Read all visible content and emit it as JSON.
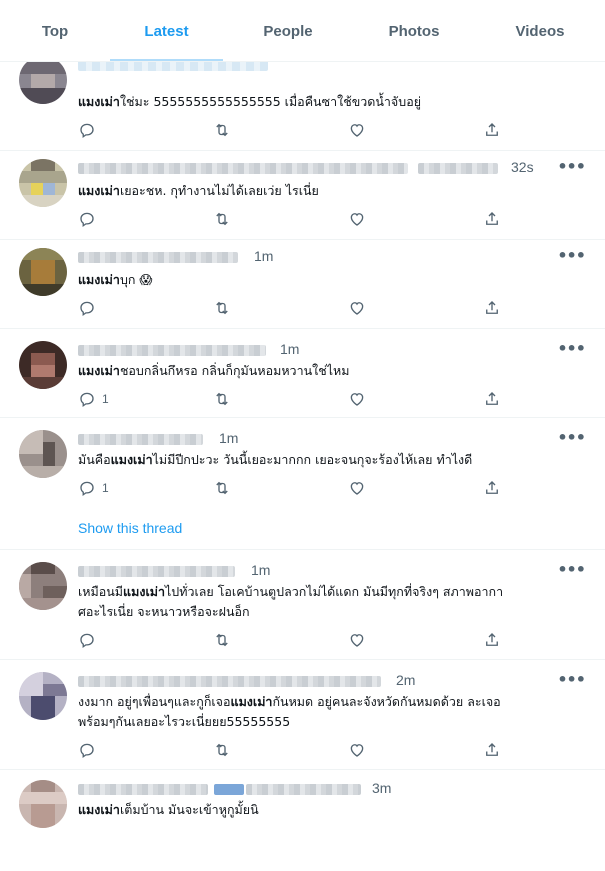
{
  "tabs": [
    {
      "label": "Top",
      "active": false
    },
    {
      "label": "Latest",
      "active": true
    },
    {
      "label": "People",
      "active": false
    },
    {
      "label": "Photos",
      "active": false
    },
    {
      "label": "Videos",
      "active": false
    }
  ],
  "colors": {
    "accent": "#1d9bf0",
    "muted": "#536471",
    "text": "#0f1419",
    "divider": "#eff3f4"
  },
  "icons": [
    "reply-icon",
    "retweet-icon",
    "like-icon",
    "share-icon",
    "more-icon"
  ],
  "tweets": [
    {
      "time": "",
      "keyword": "แมงเม่า",
      "pre": "",
      "post": "ใช่มะ 5555555555555555 เมื่อคืนซาใช้ขวดน้ำจับอยู่",
      "reply_count": ""
    },
    {
      "time": "32s",
      "keyword": "แมงเม่า",
      "pre": "",
      "post": "เยอะชห. กุทำงานไม่ได้เลยเว่ย ไรเนี่ย",
      "reply_count": ""
    },
    {
      "time": "1m",
      "keyword": "แมงเม่า",
      "pre": "",
      "post": "บุก 😱",
      "reply_count": ""
    },
    {
      "time": "1m",
      "keyword": "แมงเม่า",
      "pre": "",
      "post": "ชอบกลิ่นกึหรอ กลิ่นก็กุมันหอมหวานใช่ไหม",
      "reply_count": "1"
    },
    {
      "time": "1m",
      "keyword": "แมงเม่า",
      "pre": "มันคือ",
      "post": "ไม่มีปีกปะวะ วันนี้เยอะมากกก เยอะจนกุจะร้องไห้เลย ทำไงดี",
      "reply_count": "1",
      "thread_link": "Show this thread"
    },
    {
      "time": "1m",
      "keyword": "แมงเม่า",
      "pre": "เหมือนมี",
      "post": "ไปทั่วเลย โอเคบ้านตูปลวกไม่ได้แดก มันมีทุกที่จริงๆ สภาพอากา",
      "line2": "ศอะไรเนี่ย จะหนาวหรือจะฝนอ็ก",
      "reply_count": ""
    },
    {
      "time": "2m",
      "keyword": "แมงเม่า",
      "pre": "งงมาก อยู่ๆเพื่อนๆและกูก็เจอ",
      "post": "กันหมด อยู่คนละจังหวัดกันหมดด้วย ละเจอ",
      "line2": "พร้อมๆกันเลยอะไรวะเนี่ยยย55555555",
      "reply_count": ""
    },
    {
      "time": "3m",
      "keyword": "แมงเม่า",
      "pre": "",
      "post": "เต็มบ้าน มันจะเข้าหูกูมั้ยนิ",
      "reply_count": ""
    }
  ]
}
